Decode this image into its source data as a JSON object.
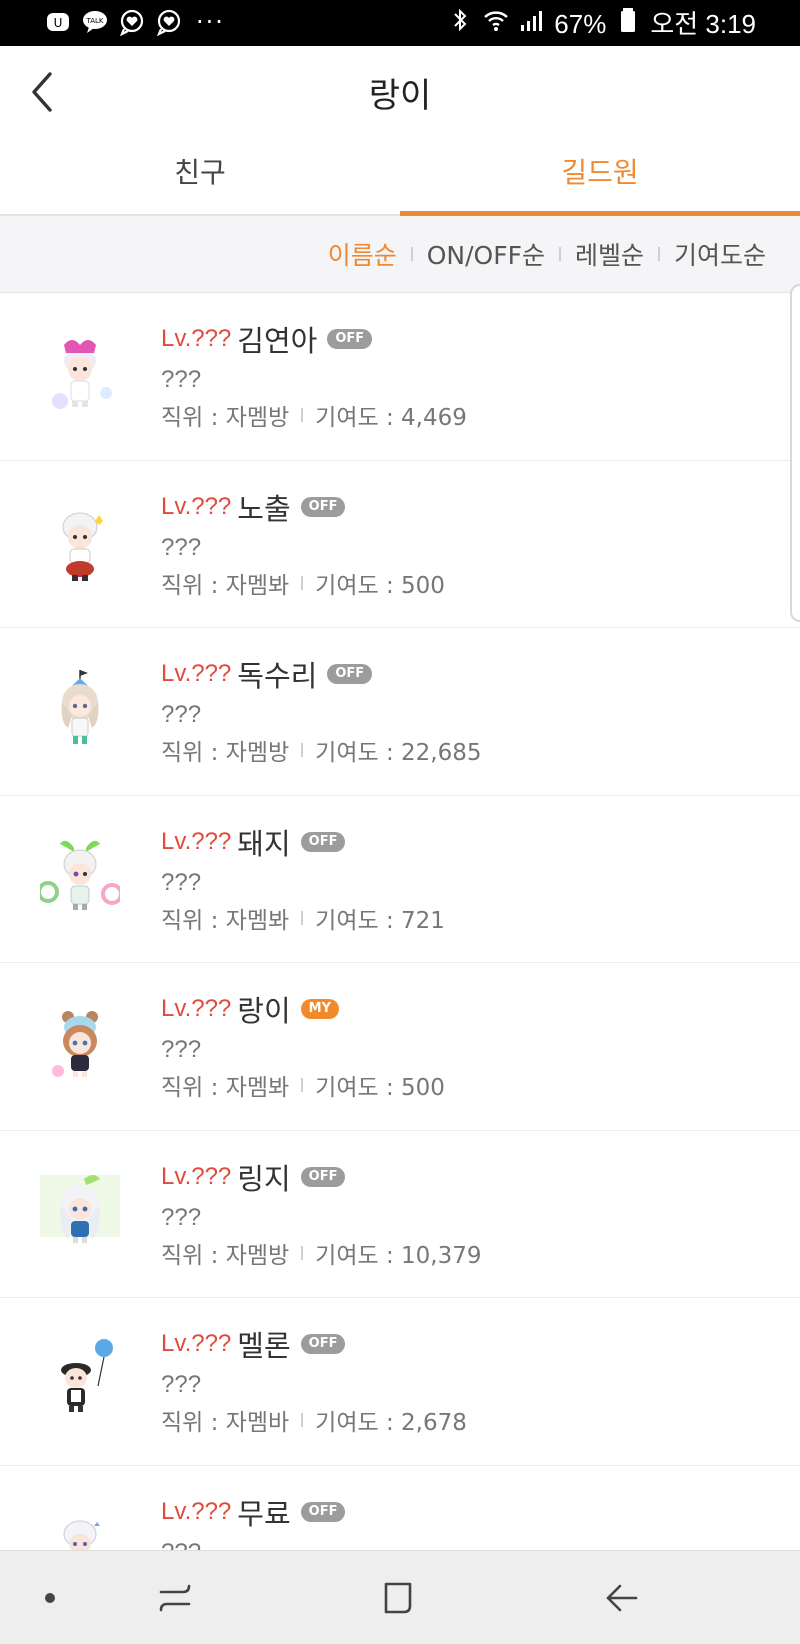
{
  "status_bar": {
    "left_icons": [
      "uplus-icon",
      "kakaotalk-icon",
      "heart-chat-icon",
      "heart-chat-icon-2"
    ],
    "overflow": "···",
    "battery_percent": "67%",
    "time": "오전 3:19"
  },
  "header": {
    "title": "랑이",
    "back_icon": "chevron-left-icon"
  },
  "tabs": [
    {
      "label": "친구",
      "active": false
    },
    {
      "label": "길드원",
      "active": true
    }
  ],
  "sort_options": [
    {
      "label": "이름순",
      "active": true
    },
    {
      "label": "ON/OFF순",
      "active": false
    },
    {
      "label": "레벨순",
      "active": false
    },
    {
      "label": "기여도순",
      "active": false
    }
  ],
  "members": [
    {
      "level": "Lv.???",
      "name": "김연아",
      "badge": "OFF",
      "status": "???",
      "rank_label": "직위 : 자멤방",
      "contribution_label": "기여도 : 4,469"
    },
    {
      "level": "Lv.???",
      "name": "노출",
      "badge": "OFF",
      "status": "???",
      "rank_label": "직위 : 자멤봐",
      "contribution_label": "기여도 : 500"
    },
    {
      "level": "Lv.???",
      "name": "독수리",
      "badge": "OFF",
      "status": "???",
      "rank_label": "직위 : 자멤방",
      "contribution_label": "기여도 : 22,685"
    },
    {
      "level": "Lv.???",
      "name": "돼지",
      "badge": "OFF",
      "status": "???",
      "rank_label": "직위 : 자멤봐",
      "contribution_label": "기여도 : 721"
    },
    {
      "level": "Lv.???",
      "name": "랑이",
      "badge": "MY",
      "status": "???",
      "rank_label": "직위 : 자멤봐",
      "contribution_label": "기여도 : 500"
    },
    {
      "level": "Lv.???",
      "name": "링지",
      "badge": "OFF",
      "status": "???",
      "rank_label": "직위 : 자멤방",
      "contribution_label": "기여도 : 10,379"
    },
    {
      "level": "Lv.???",
      "name": "멜론",
      "badge": "OFF",
      "status": "???",
      "rank_label": "직위 : 자멤바",
      "contribution_label": "기여도 : 2,678"
    },
    {
      "level": "Lv.???",
      "name": "무료",
      "badge": "OFF",
      "status": "???",
      "rank_label": "",
      "contribution_label": ""
    }
  ],
  "nav_bar": [
    "dot-icon",
    "recents-icon",
    "home-icon",
    "back-arrow-icon"
  ],
  "colors": {
    "accent": "#ee8a34",
    "level": "#e04b3c",
    "badge_off": "#9c9c9c",
    "badge_my": "#f08a2c"
  }
}
